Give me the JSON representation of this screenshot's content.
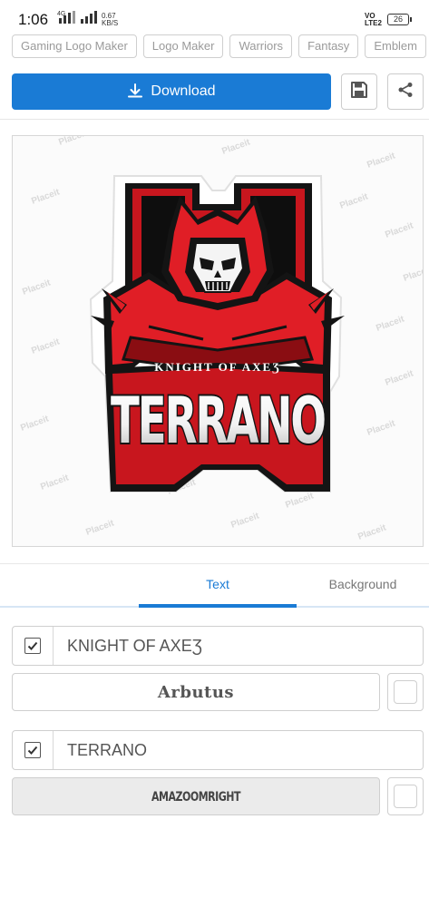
{
  "status_bar": {
    "time": "1:06",
    "network": "4G",
    "speed_value": "0.67",
    "speed_unit": "KB/S",
    "volte_top": "VO",
    "volte_bottom": "LTE2",
    "battery": "26"
  },
  "tag_chips": [
    "Gaming Logo Maker",
    "Logo Maker",
    "Warriors",
    "Fantasy",
    "Emblem"
  ],
  "toolbar": {
    "download_label": "Download",
    "download_icon": "download-icon",
    "save_icon": "floppy-disk-icon",
    "share_icon": "share-icon"
  },
  "logo": {
    "subtitle": "KNIGHT OF AXEƷ",
    "title": "TERRANO",
    "watermark": "Placeit",
    "colors": {
      "primary_red": "#e01e26",
      "dark_red": "#8a0d12",
      "outline": "#111111",
      "skull": "#f4f4f4"
    }
  },
  "tabs": {
    "items": [
      "Text",
      "Background"
    ],
    "active": "Text"
  },
  "text_layers": [
    {
      "checked": true,
      "value": "KNIGHT OF AXEƷ",
      "font": "Arbutus",
      "font_bg": "#ffffff"
    },
    {
      "checked": true,
      "value": "TERRANO",
      "font": "AMAZOOMRIGHT",
      "font_bg": "#ebebeb"
    }
  ],
  "accent_color": "#1a7bd5"
}
